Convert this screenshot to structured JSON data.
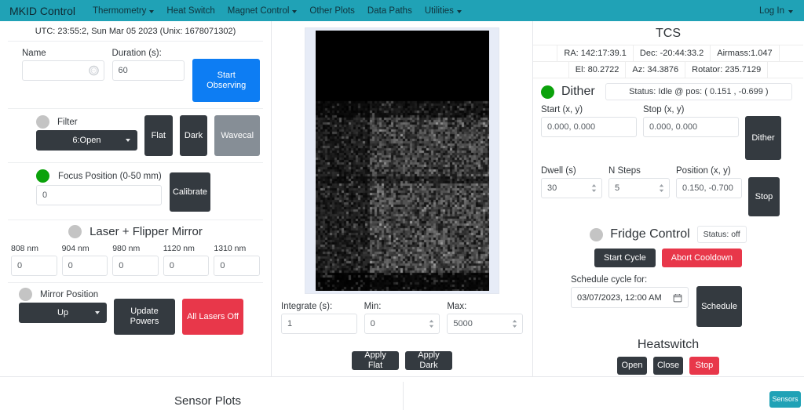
{
  "navbar": {
    "brand": "MKID Control",
    "items": [
      {
        "label": "Thermometry",
        "caret": true
      },
      {
        "label": "Heat Switch",
        "caret": false
      },
      {
        "label": "Magnet Control",
        "caret": true
      },
      {
        "label": "Other Plots",
        "caret": false
      },
      {
        "label": "Data Paths",
        "caret": false
      },
      {
        "label": "Utilities",
        "caret": true
      }
    ],
    "login": "Log In",
    "bg_color": "#20a2b6"
  },
  "observe": {
    "utc_line": "UTC: 23:55:2, Sun Mar 05 2023  (Unix: 1678071302)",
    "name_label": "Name",
    "name_value": "",
    "name_placeholder": "",
    "name_icon": "spinner-icon",
    "duration_label": "Duration (s):",
    "duration_value": "60",
    "start_button": "Start Observing",
    "start_color": "#0d7df3"
  },
  "filter": {
    "indicator": "gray",
    "label": "Filter",
    "selected": "6:Open",
    "options": [
      "6:Open"
    ],
    "buttons": [
      {
        "label": "Flat",
        "style": "dark"
      },
      {
        "label": "Dark",
        "style": "dark"
      },
      {
        "label": "Wavecal",
        "style": "gray"
      }
    ]
  },
  "focus": {
    "indicator": "green",
    "label": "Focus Position (0-50 mm)",
    "value": "0",
    "button": "Calibrate"
  },
  "laser": {
    "indicator": "gray",
    "title": "Laser + Flipper Mirror",
    "channels": [
      {
        "label": "808 nm",
        "value": "0"
      },
      {
        "label": "904 nm",
        "value": "0"
      },
      {
        "label": "980 nm",
        "value": "0"
      },
      {
        "label": "1120 nm",
        "value": "0"
      },
      {
        "label": "1310 nm",
        "value": "0"
      }
    ],
    "mirror_indicator": "gray",
    "mirror_label": "Mirror Position",
    "mirror_selected": "Up",
    "mirror_options": [
      "Up"
    ],
    "update_button": "Update Powers",
    "alloff_button": "All Lasers Off",
    "alloff_color": "#e8374a"
  },
  "image_panel": {
    "integrate_label": "Integrate (s):",
    "integrate_value": "1",
    "min_label": "Min:",
    "min_value": "0",
    "max_label": "Max:",
    "max_value": "5000",
    "apply_flat": "Apply Flat",
    "apply_dark": "Apply Dark"
  },
  "tcs": {
    "title": "TCS",
    "row1": [
      "RA: 142:17:39.1",
      "Dec:  -20:44:33.2",
      "Airmass:1.047"
    ],
    "row2": [
      "El: 80.2722",
      "Az: 34.3876",
      "Rotator: 235.7129"
    ]
  },
  "dither": {
    "indicator": "green",
    "title": "Dither",
    "status": "Status:  Idle  @ pos: ( 0.151 , -0.699 )",
    "start_label": "Start (x, y)",
    "start_value": "0.000, 0.000",
    "stop_label": "Stop (x, y)",
    "stop_value": "0.000, 0.000",
    "dither_button": "Dither",
    "dwell_label": "Dwell (s)",
    "dwell_value": "30",
    "nsteps_label": "N Steps",
    "nsteps_value": "5",
    "position_label": "Position (x, y)",
    "position_value": "0.150, -0.700",
    "stop_button": "Stop"
  },
  "fridge": {
    "indicator": "gray",
    "title": "Fridge Control",
    "status": "Status:  off",
    "start_cycle": "Start Cycle",
    "abort_cooldown": "Abort Cooldown",
    "abort_color": "#e8374a",
    "schedule_label": "Schedule cycle for:",
    "schedule_value": "03/07/2023, 12:00 AM",
    "schedule_icon": "calendar-icon",
    "schedule_button": "Schedule"
  },
  "heatswitch": {
    "title": "Heatswitch",
    "buttons": [
      {
        "label": "Open",
        "style": "dark"
      },
      {
        "label": "Close",
        "style": "dark"
      },
      {
        "label": "Stop",
        "style": "red"
      }
    ]
  },
  "footer": {
    "sensor_plots_title": "Sensor Plots",
    "sensors_button": "Sensors"
  }
}
